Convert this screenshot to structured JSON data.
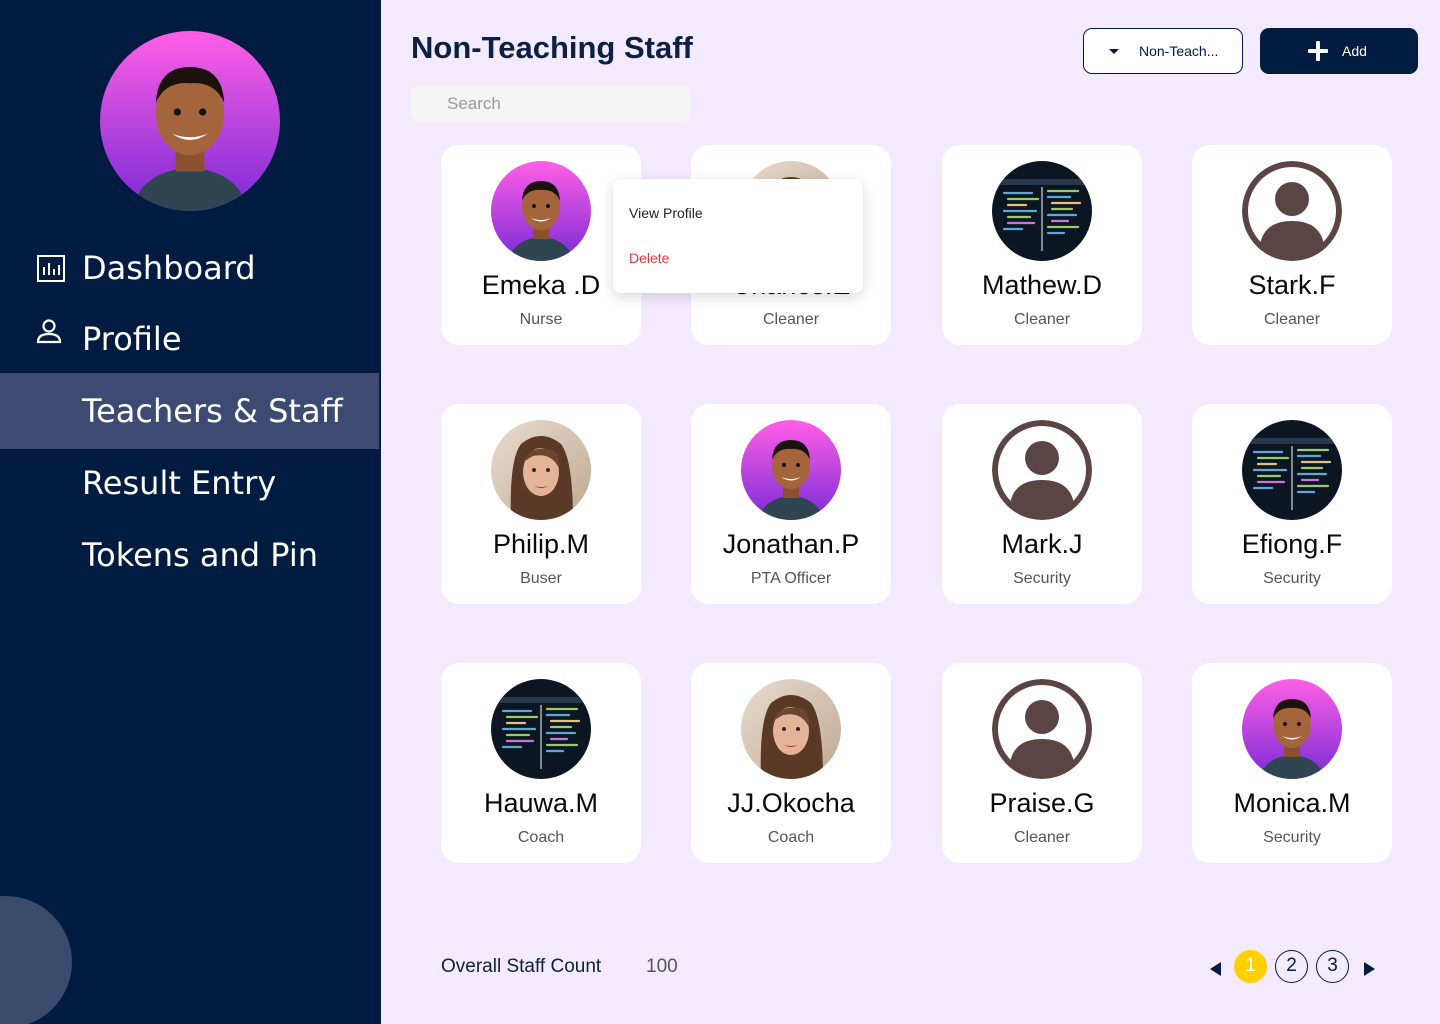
{
  "sidebar": {
    "nav": [
      {
        "label": "Dashboard",
        "icon": "bar-chart-icon"
      },
      {
        "label": "Profile",
        "icon": "person-icon"
      },
      {
        "label": "Teachers & Staff",
        "active": true
      },
      {
        "label": "Result Entry"
      },
      {
        "label": "Tokens and Pin"
      }
    ],
    "colors": {
      "background": "#021b41",
      "active": "#3d4a72"
    }
  },
  "header": {
    "title": "Non-Teaching Staff",
    "search_placeholder": "Search",
    "filter_value": "Non-Teach...",
    "add_label": "Add"
  },
  "staff": [
    {
      "name": "Emeka .D",
      "role": "Nurse",
      "photo": "man-purple"
    },
    {
      "name": "Charles.E",
      "role": "Cleaner",
      "photo": "woman"
    },
    {
      "name": "Mathew.D",
      "role": "Cleaner",
      "photo": "code"
    },
    {
      "name": "Stark.F",
      "role": "Cleaner",
      "photo": "placeholder"
    },
    {
      "name": "Philip.M",
      "role": "Buser",
      "photo": "woman"
    },
    {
      "name": "Jonathan.P",
      "role": "PTA Officer",
      "photo": "man-purple"
    },
    {
      "name": "Mark.J",
      "role": "Security",
      "photo": "placeholder"
    },
    {
      "name": "Efiong.F",
      "role": "Security",
      "photo": "code"
    },
    {
      "name": "Hauwa.M",
      "role": "Coach",
      "photo": "code"
    },
    {
      "name": "JJ.Okocha",
      "role": "Coach",
      "photo": "woman"
    },
    {
      "name": "Praise.G",
      "role": "Cleaner",
      "photo": "placeholder"
    },
    {
      "name": "Monica.M",
      "role": "Security",
      "photo": "man-purple"
    }
  ],
  "context_menu": {
    "view": "View Profile",
    "delete": "Delete"
  },
  "footer": {
    "count_label": "Overall Staff Count",
    "count_value": "100",
    "pages": [
      "1",
      "2",
      "3"
    ],
    "current_page": "1",
    "accent": "#ffd000"
  }
}
